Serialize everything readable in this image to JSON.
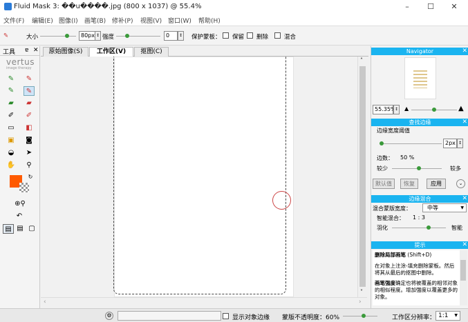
{
  "window": {
    "title": "Fluid Mask 3: ��u����.jpg (800 x 1037) @ 55.4%",
    "minimize": "–",
    "maximize": "☐",
    "close": "✕"
  },
  "menu": [
    "文件(F)",
    "编辑(E)",
    "图像(I)",
    "画笔(B)",
    "修补(P)",
    "视图(V)",
    "窗口(W)",
    "帮助(H)"
  ],
  "toolbar": {
    "size_label": "大小",
    "size_value": "80px",
    "opacity_label": "强度",
    "opacity_value": "0",
    "protect_label": "保护蒙板：",
    "keep_label": "保留",
    "delete_label": "删除",
    "mix_label": "混合"
  },
  "tools_panel": {
    "title": "工具",
    "pin": "ɐ",
    "close": "✕",
    "logo": "vertus",
    "logo_sub": "image therapy",
    "accent_color": "#ff5a00"
  },
  "tabs": [
    "原始图像(S)",
    "工作区(V)",
    "抠图(C)"
  ],
  "active_tab": 1,
  "navigator": {
    "title": "Navigator",
    "zoom_value": "55.35%"
  },
  "edge_panel": {
    "title": "查找边缘",
    "threshold_label": "边缘宽度阈值",
    "threshold_value": "2px",
    "edge_label": "边数：",
    "edge_value": "50 %",
    "less": "较少",
    "more": "较多",
    "default_btn": "默认值",
    "restore_btn": "恢复",
    "apply_btn": "应用"
  },
  "blend_panel": {
    "title": "边缘混合",
    "mode_label": "混合蒙版宽度：",
    "mode_value": "中等",
    "smart_label": "智能混合：",
    "smart_value": "1 : 3",
    "feather_label": "羽化",
    "smart_end": "智能"
  },
  "tips_panel": {
    "title": "提示",
    "heading": "删除局部画笔",
    "shortcut": "(Shift+D)",
    "para1": "在对象上注涂-填充删除蒙板。然后将其从最后的抠图中删除。",
    "para2_bold": "画笔强度",
    "para2": "确定也将被覆盖的相邻对象的相似程度。增加强度以覆盖更多的对象。"
  },
  "status": {
    "show_edges": "显示对象边缘",
    "mask_opacity": "蒙版不透明度：60%",
    "mask_opacity_level": 0.6,
    "resolution_label": "工作区分辨率：",
    "resolution_value": "1:1"
  }
}
